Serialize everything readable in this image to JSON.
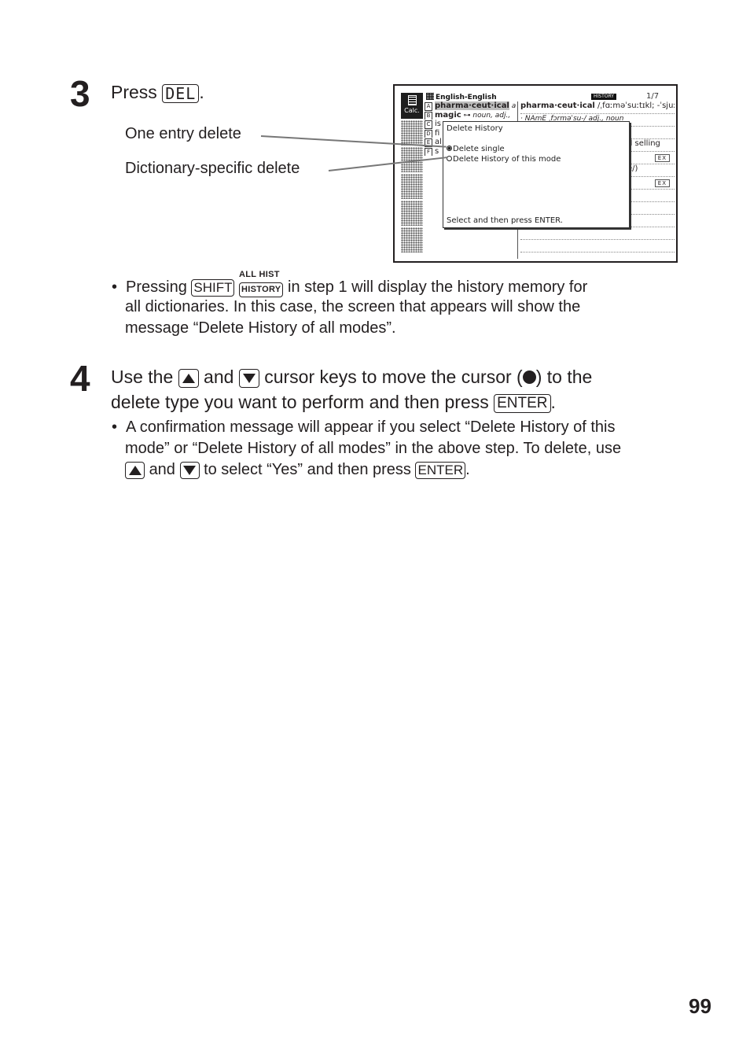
{
  "step3": {
    "number": "3",
    "press_label": "Press",
    "del_key": "DEL",
    "period": ".",
    "callouts": [
      "One entry delete",
      "Dictionary-specific delete"
    ]
  },
  "lcd": {
    "calc_label": "Calc.",
    "title": "English-English",
    "history_badge": "HISTORY",
    "page": "1/7",
    "list": [
      {
        "letter": "A",
        "word": "pharma·ceut·ical",
        "rest": " a",
        "selected": true
      },
      {
        "letter": "B",
        "word": "magic",
        "rest": " ⊶ noun, adj.,",
        "selected": false
      },
      {
        "letter": "C",
        "word": "is",
        "rest": "",
        "selected": false
      },
      {
        "letter": "D",
        "word": "fi",
        "rest": "",
        "selected": false
      },
      {
        "letter": "E",
        "word": "al",
        "rest": "",
        "selected": false
      },
      {
        "letter": "F",
        "word": "s",
        "rest": "",
        "selected": false
      }
    ],
    "definition": {
      "headword": "pharma·ceut·ical",
      "pron": " /ˌfɑːməˈsuːtɪkl; -ˈsjuː-",
      "line2": "· NAmE ˌfɔrməˈsu-/ adj., noun",
      "line4": "d selling",
      "line6": "e/)",
      "ex_label": "EX"
    },
    "dialog": {
      "title": "Delete History",
      "options": [
        "Delete single",
        "Delete History of this mode"
      ],
      "selected_index": 0,
      "footer": "Select and then press ENTER."
    }
  },
  "note1": {
    "line1_pre": "Pressing",
    "shift_key": "SHIFT",
    "history_top": "ALL HIST",
    "history_key": "HISTORY",
    "line1_post": "in step 1 will display the history memory for",
    "line2": "all dictionaries. In this case, the screen that appears will show the",
    "line3": "message “Delete History of all modes”."
  },
  "step4": {
    "number": "4",
    "l1_a": "Use the",
    "l1_b": "and",
    "l1_c": "cursor keys to move the cursor (",
    "l1_d": ") to the",
    "l2": "delete type you want to perform and then press",
    "enter_key": "ENTER",
    "period": ".",
    "note_l1": "A confirmation message will appear if you select “Delete History of this",
    "note_l2": "mode” or “Delete History of all modes” in the above step. To delete, use",
    "note_l3_a": "and",
    "note_l3_b": "to select “Yes” and then press",
    "note_enter": "ENTER",
    "note_period": "."
  },
  "page_number": "99"
}
